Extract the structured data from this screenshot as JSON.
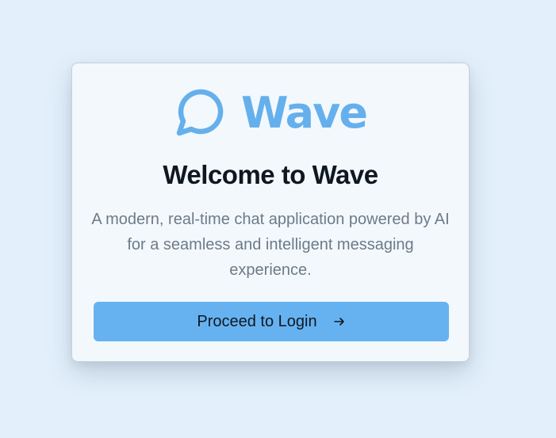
{
  "brand": {
    "icon": "chat-bubble-icon",
    "name": "Wave",
    "color": "#65b0ec"
  },
  "title": "Welcome to Wave",
  "description": "A modern, real-time chat application powered by AI for a seamless and intelligent messaging experience.",
  "button": {
    "label": "Proceed to Login",
    "icon": "arrow-right-icon",
    "color": "#66b2f1"
  },
  "colors": {
    "background": "#e3f0fc",
    "card": "#f3f8fd",
    "title": "#0f1720",
    "description": "#6d7b86"
  }
}
